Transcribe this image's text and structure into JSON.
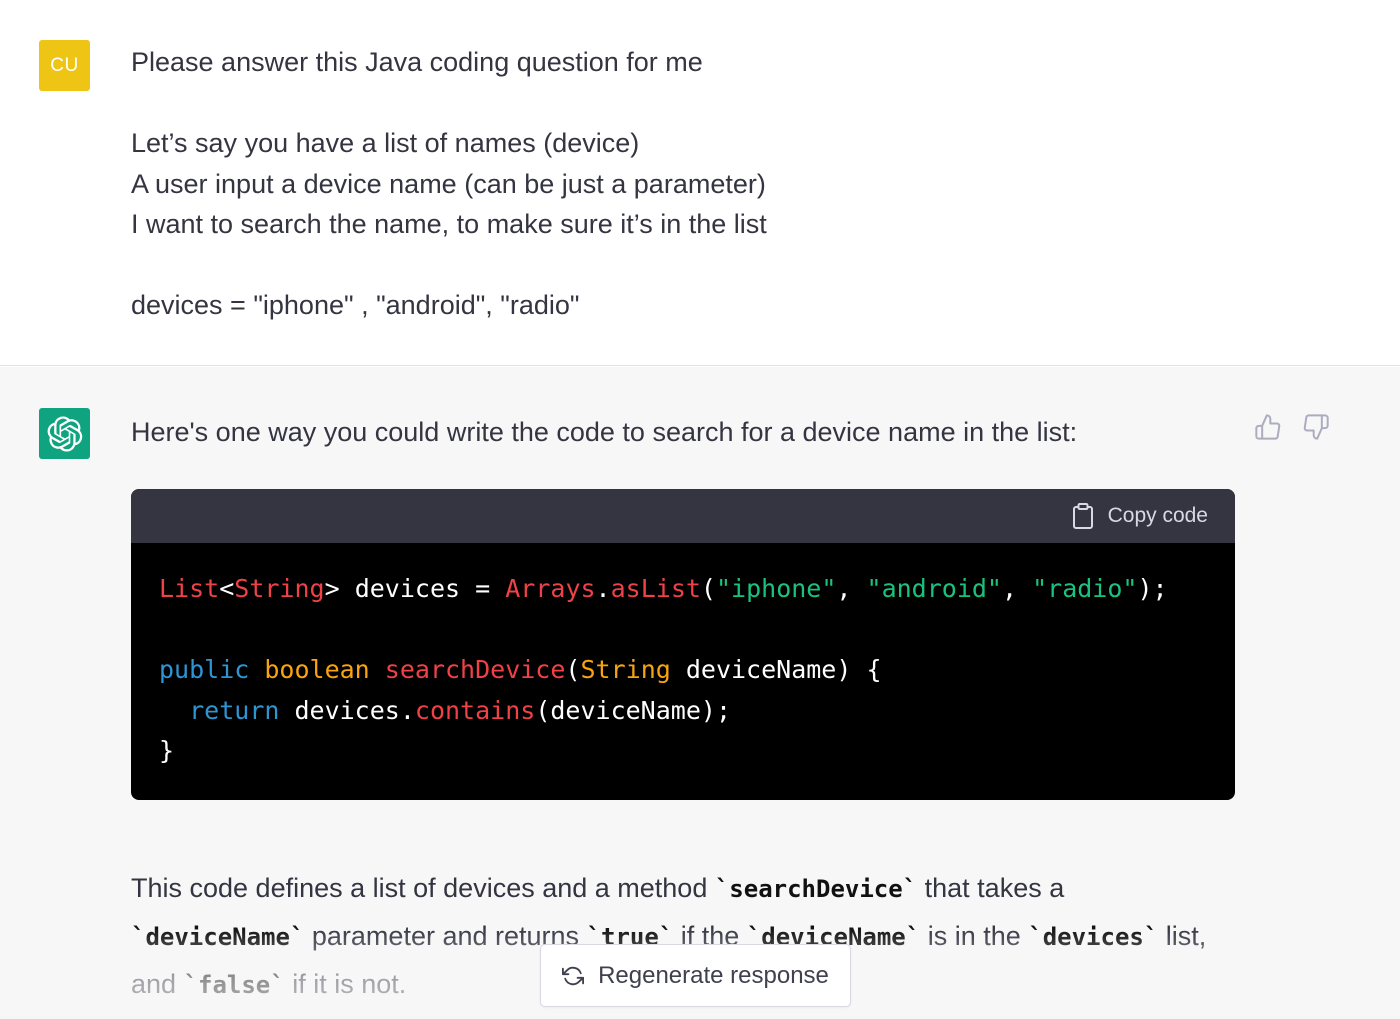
{
  "user": {
    "avatar_initials": "CU",
    "avatar_color": "#eec515",
    "message": "Please answer this Java coding question for me\n\nLet’s say you have a list of names (device)\nA user input a device name (can be just a parameter)\nI want to search the name, to make sure it’s in the list\n\ndevices = \"iphone\" , \"android\", \"radio\""
  },
  "assistant": {
    "avatar_icon": "openai-logo-icon",
    "avatar_color": "#10a37f",
    "intro": "Here's one way you could write the code to search for a device name in the list:",
    "feedback": {
      "thumbs_up_icon": "thumbs-up-icon",
      "thumbs_down_icon": "thumbs-down-icon"
    },
    "code_block": {
      "copy_label": "Copy code",
      "copy_icon": "clipboard-icon",
      "tokens": {
        "list": "List",
        "lt": "<",
        "string1": "String",
        "gt": ">",
        "devices_decl": " devices = ",
        "arrays": "Arrays",
        "dot1": ".",
        "aslist": "asList",
        "paren_open": "(",
        "str_iphone": "\"iphone\"",
        "comma1": ", ",
        "str_android": "\"android\"",
        "comma2": ", ",
        "str_radio": "\"radio\"",
        "paren_close": ");",
        "public": "public",
        "boolean": "boolean",
        "search_device": "searchDevice",
        "paren_open2": "(",
        "string2": "String",
        "param": " deviceName) {",
        "indent": "  ",
        "return": "return",
        "devices_ref": " devices",
        "dot2": ".",
        "contains": "contains",
        "contains_args": "(deviceName);",
        "close_brace": "}"
      }
    },
    "explanation": {
      "p1": "This code defines a list of devices and a method ",
      "c1": "`searchDevice`",
      "p2": " that takes a ",
      "c2": "`deviceName`",
      "p3": " parameter and returns ",
      "c3": "`true`",
      "p4": " if the ",
      "c4": "`deviceName`",
      "p5": " is in the ",
      "c5": "`devices`",
      "p6": " list, and ",
      "c6": "`false`",
      "p7": " if it is not."
    }
  },
  "regenerate": {
    "label": "Regenerate response",
    "icon": "refresh-icon"
  }
}
